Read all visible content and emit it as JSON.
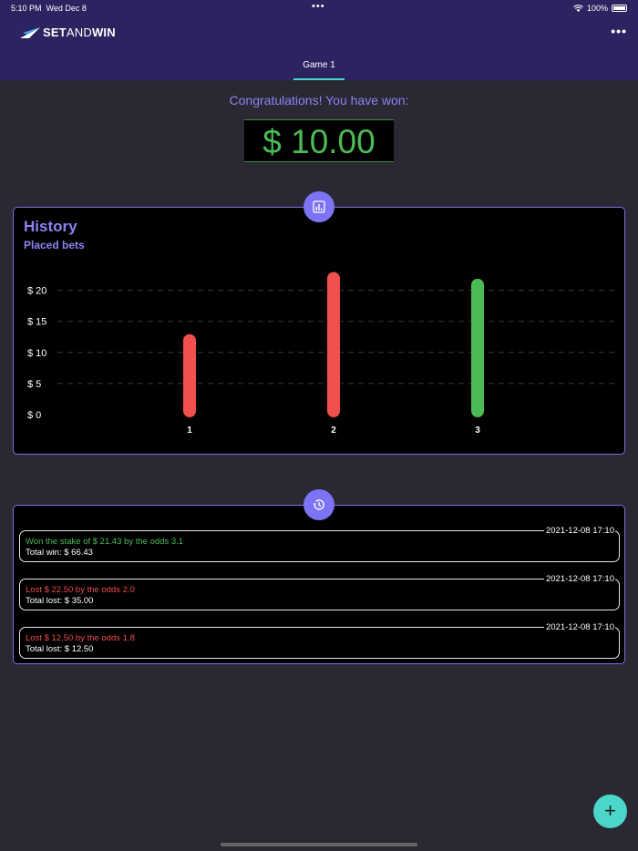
{
  "status": {
    "time": "5:10 PM",
    "date": "Wed Dec 8",
    "dots": "•••",
    "battery": "100%"
  },
  "header": {
    "logo_bold1": "SET",
    "logo_thin": "AND",
    "logo_bold2": "WIN",
    "menu_icon": "more-horizontal-icon"
  },
  "tabs": [
    {
      "label": "Game 1",
      "selected": true
    }
  ],
  "main": {
    "congrats": "Congratulations! You have won:",
    "amount": "$ 10.00"
  },
  "history": {
    "title": "History",
    "subtitle": "Placed bets",
    "icon": "bar-chart-icon",
    "chart_data": {
      "type": "bar",
      "categories": [
        "1",
        "2",
        "3"
      ],
      "values": [
        12.5,
        22.5,
        21.43
      ],
      "colors": [
        "#f24f4f",
        "#f24f4f",
        "#4cbb55"
      ],
      "y_ticks": [
        0,
        5,
        10,
        15,
        20
      ],
      "y_tick_labels": [
        "$ 0",
        "$ 5",
        "$ 10",
        "$ 15",
        "$ 20"
      ],
      "ylim": [
        0,
        25
      ],
      "grid": true
    }
  },
  "log": {
    "icon": "history-icon",
    "entries": [
      {
        "line1": "Won the stake of $ 21.43 by the odds 3.1",
        "line2": "Total win: $ 66.43",
        "time": "2021-12-08 17:10",
        "status": "won"
      },
      {
        "line1": "Lost $ 22.50 by the odds 2.0",
        "line2": "Total lost: $ 35.00",
        "time": "2021-12-08 17:10",
        "status": "lost"
      },
      {
        "line1": "Lost $ 12.50 by the odds 1.8",
        "line2": "Total lost: $ 12.50",
        "time": "2021-12-08 17:10",
        "status": "lost"
      }
    ]
  },
  "fab": {
    "label": "+"
  },
  "colors": {
    "accent": "#7c74f4",
    "teal": "#4ad6c8",
    "header_bg": "#2d2360",
    "won": "#4cbb55",
    "lost": "#ef4d4d"
  }
}
